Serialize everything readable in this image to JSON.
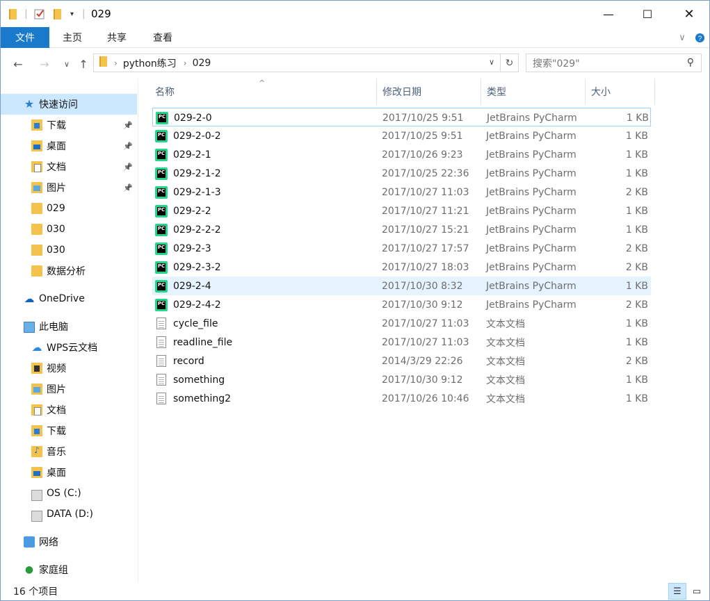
{
  "window": {
    "title": "029"
  },
  "ribbon": {
    "tabs": [
      "文件",
      "主页",
      "共享",
      "查看"
    ]
  },
  "address": {
    "crumbs": [
      "python练习",
      "029"
    ]
  },
  "search": {
    "placeholder": "搜索\"029\""
  },
  "nav": {
    "quick_access": "快速访问",
    "items": [
      {
        "label": "下载",
        "icon": "download-folder-icon",
        "pinned": true
      },
      {
        "label": "桌面",
        "icon": "desktop-folder-icon",
        "pinned": true
      },
      {
        "label": "文档",
        "icon": "documents-folder-icon",
        "pinned": true
      },
      {
        "label": "图片",
        "icon": "pictures-folder-icon",
        "pinned": true
      },
      {
        "label": "029",
        "icon": "folder-icon",
        "pinned": false
      },
      {
        "label": "030",
        "icon": "folder-icon",
        "pinned": false
      },
      {
        "label": "030",
        "icon": "folder-icon",
        "pinned": false
      },
      {
        "label": "数据分析",
        "icon": "folder-icon",
        "pinned": false
      }
    ],
    "onedrive": "OneDrive",
    "this_pc": "此电脑",
    "pc_items": [
      {
        "label": "WPS云文档",
        "icon": "wps-cloud-icon"
      },
      {
        "label": "视频",
        "icon": "videos-folder-icon"
      },
      {
        "label": "图片",
        "icon": "pictures-folder-icon"
      },
      {
        "label": "文档",
        "icon": "documents-folder-icon"
      },
      {
        "label": "下载",
        "icon": "download-folder-icon"
      },
      {
        "label": "音乐",
        "icon": "music-folder-icon"
      },
      {
        "label": "桌面",
        "icon": "desktop-folder-icon"
      },
      {
        "label": "OS (C:)",
        "icon": "windows-drive-icon"
      },
      {
        "label": "DATA (D:)",
        "icon": "drive-icon"
      }
    ],
    "network": "网络",
    "homegroup": "家庭组"
  },
  "columns": {
    "name": "名称",
    "date": "修改日期",
    "type": "类型",
    "size": "大小"
  },
  "files": [
    {
      "name": "029-2-0",
      "date": "2017/10/25 9:51",
      "type": "JetBrains PyCharm",
      "size": "1 KB",
      "kind": "pycharm"
    },
    {
      "name": "029-2-0-2",
      "date": "2017/10/25 9:51",
      "type": "JetBrains PyCharm",
      "size": "1 KB",
      "kind": "pycharm"
    },
    {
      "name": "029-2-1",
      "date": "2017/10/26 9:23",
      "type": "JetBrains PyCharm",
      "size": "1 KB",
      "kind": "pycharm"
    },
    {
      "name": "029-2-1-2",
      "date": "2017/10/25 22:36",
      "type": "JetBrains PyCharm",
      "size": "1 KB",
      "kind": "pycharm"
    },
    {
      "name": "029-2-1-3",
      "date": "2017/10/27 11:03",
      "type": "JetBrains PyCharm",
      "size": "2 KB",
      "kind": "pycharm"
    },
    {
      "name": "029-2-2",
      "date": "2017/10/27 11:21",
      "type": "JetBrains PyCharm",
      "size": "1 KB",
      "kind": "pycharm"
    },
    {
      "name": "029-2-2-2",
      "date": "2017/10/27 15:21",
      "type": "JetBrains PyCharm",
      "size": "1 KB",
      "kind": "pycharm"
    },
    {
      "name": "029-2-3",
      "date": "2017/10/27 17:57",
      "type": "JetBrains PyCharm",
      "size": "2 KB",
      "kind": "pycharm"
    },
    {
      "name": "029-2-3-2",
      "date": "2017/10/27 18:03",
      "type": "JetBrains PyCharm",
      "size": "2 KB",
      "kind": "pycharm"
    },
    {
      "name": "029-2-4",
      "date": "2017/10/30 8:32",
      "type": "JetBrains PyCharm",
      "size": "1 KB",
      "kind": "pycharm"
    },
    {
      "name": "029-2-4-2",
      "date": "2017/10/30 9:12",
      "type": "JetBrains PyCharm",
      "size": "2 KB",
      "kind": "pycharm"
    },
    {
      "name": "cycle_file",
      "date": "2017/10/27 11:03",
      "type": "文本文档",
      "size": "1 KB",
      "kind": "text"
    },
    {
      "name": "readline_file",
      "date": "2017/10/27 11:03",
      "type": "文本文档",
      "size": "1 KB",
      "kind": "text"
    },
    {
      "name": "record",
      "date": "2014/3/29 22:26",
      "type": "文本文档",
      "size": "2 KB",
      "kind": "text"
    },
    {
      "name": "something",
      "date": "2017/10/30 9:12",
      "type": "文本文档",
      "size": "1 KB",
      "kind": "text"
    },
    {
      "name": "something2",
      "date": "2017/10/26 10:46",
      "type": "文本文档",
      "size": "1 KB",
      "kind": "text"
    }
  ],
  "selected_index": 9,
  "focused_index": 0,
  "status": {
    "count": "16 个项目"
  }
}
